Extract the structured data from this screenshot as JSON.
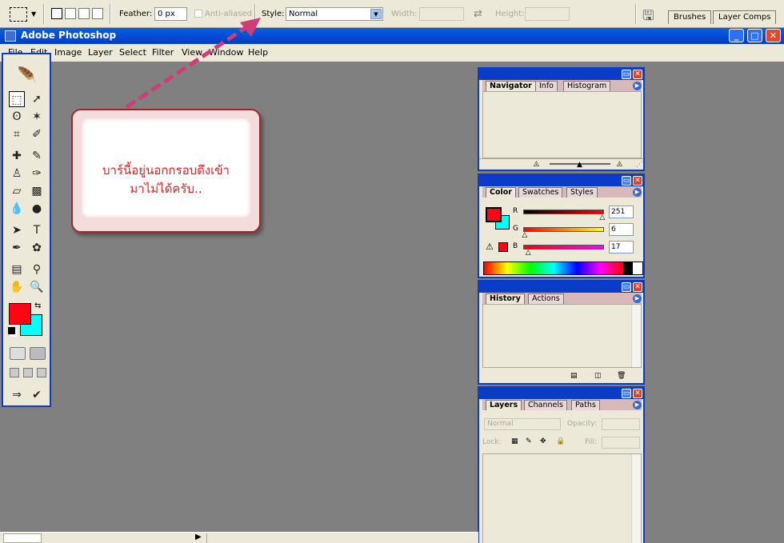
{
  "options_bar": {
    "feather_label": "Feather:",
    "feather_value": "0 px",
    "anti_alias_label": "Anti-aliased",
    "style_label": "Style:",
    "style_value": "Normal",
    "width_label": "Width:",
    "height_label": "Height:",
    "tab_brushes": "Brushes",
    "tab_layer_comps": "Layer Comps"
  },
  "window": {
    "title": "Adobe Photoshop"
  },
  "menu": [
    "File",
    "Edit",
    "Image",
    "Layer",
    "Select",
    "Filter",
    "View",
    "Window",
    "Help"
  ],
  "callout": {
    "line1": "บาร์นี้อยู่นอกกรอบดึงเข้า",
    "line2": "มาไม่ได้ครับ.."
  },
  "panels": {
    "navigator": {
      "tabs": [
        "Navigator",
        "Info",
        "Histogram"
      ]
    },
    "color": {
      "tabs": [
        "Color",
        "Swatches",
        "Styles"
      ],
      "r_label": "R",
      "g_label": "G",
      "b_label": "B",
      "r_value": "251",
      "g_value": "6",
      "b_value": "17",
      "r_level": 0.984,
      "g_level": 0.024,
      "b_level": 0.067
    },
    "history": {
      "tabs": [
        "History",
        "Actions"
      ]
    },
    "layers": {
      "tabs": [
        "Layers",
        "Channels",
        "Paths"
      ],
      "blend_mode": "Normal",
      "opacity_label": "Opacity:",
      "lock_label": "Lock:",
      "fill_label": "Fill:"
    }
  },
  "colors": {
    "foreground": "#fb0611",
    "background": "#00ffff",
    "callout_text": "#e02020",
    "title_bar": "#0a5fe0"
  }
}
